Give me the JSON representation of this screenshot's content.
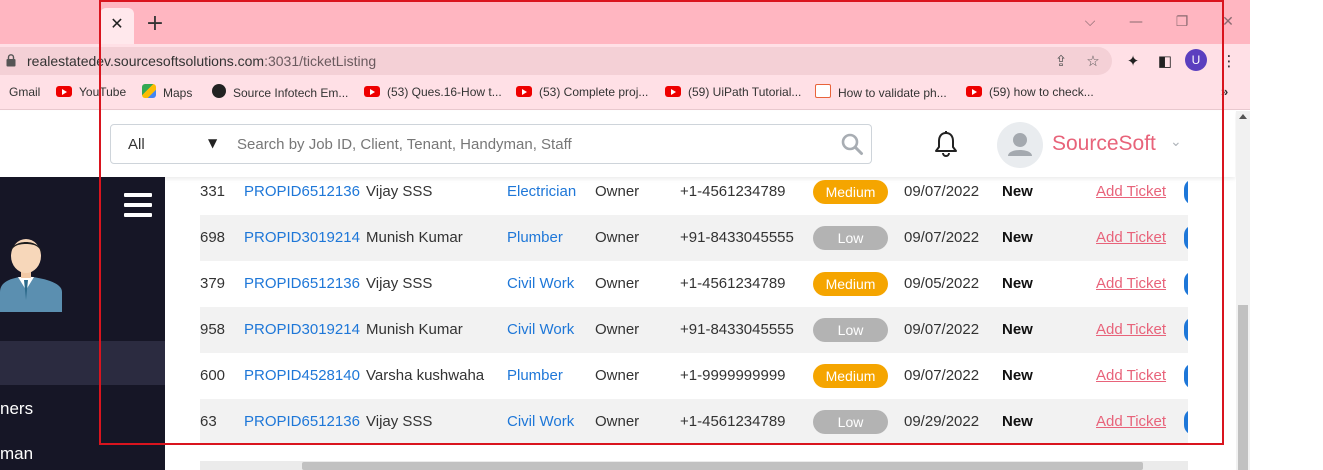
{
  "browser": {
    "tab_close": "✕",
    "new_tab": "+",
    "window_controls": {
      "tab_search": "⌵",
      "minimize": "—",
      "restore": "❐",
      "close": "✕"
    },
    "url_host": "realestatedev.sourcesoftsolutions.com",
    "url_path": ":3031/ticketListing",
    "profile_initial": "U",
    "bookmarks": [
      {
        "label": "Gmail",
        "icon": "gmail-icon"
      },
      {
        "label": "YouTube",
        "icon": "youtube-icon"
      },
      {
        "label": "Maps",
        "icon": "maps-icon"
      },
      {
        "label": "Source Infotech Em...",
        "icon": "globe-icon"
      },
      {
        "label": "(53) Ques.16-How t...",
        "icon": "youtube-icon"
      },
      {
        "label": "(53) Complete proj...",
        "icon": "youtube-icon"
      },
      {
        "label": "(59) UiPath Tutorial...",
        "icon": "youtube-icon"
      },
      {
        "label": "How to validate ph...",
        "icon": "uipath-icon"
      },
      {
        "label": "(59) how to check...",
        "icon": "youtube-icon"
      }
    ],
    "bookmarks_more": "»"
  },
  "header": {
    "filter_selected": "All",
    "search_placeholder": "Search by Job ID, Client, Tenant, Handyman, Staff",
    "brand": "SourceSoft",
    "brand_chevron": "⌄"
  },
  "sidebar": {
    "items": [
      {
        "label": "ners"
      },
      {
        "label": "man"
      }
    ]
  },
  "table": {
    "rows": [
      {
        "id": "331",
        "property": "PROPID6512136",
        "client": "Vijay SSS",
        "job_type": "Electrician",
        "role": "Owner",
        "phone": "+1-4561234789",
        "priority": "Medium",
        "date": "09/07/2022",
        "status": "New",
        "action": "Add Ticket"
      },
      {
        "id": "698",
        "property": "PROPID3019214",
        "client": "Munish Kumar",
        "job_type": "Plumber",
        "role": "Owner",
        "phone": "+91-8433045555",
        "priority": "Low",
        "date": "09/07/2022",
        "status": "New",
        "action": "Add Ticket"
      },
      {
        "id": "379",
        "property": "PROPID6512136",
        "client": "Vijay SSS",
        "job_type": "Civil Work",
        "role": "Owner",
        "phone": "+1-4561234789",
        "priority": "Medium",
        "date": "09/05/2022",
        "status": "New",
        "action": "Add Ticket"
      },
      {
        "id": "958",
        "property": "PROPID3019214",
        "client": "Munish Kumar",
        "job_type": "Civil Work",
        "role": "Owner",
        "phone": "+91-8433045555",
        "priority": "Low",
        "date": "09/07/2022",
        "status": "New",
        "action": "Add Ticket"
      },
      {
        "id": "600",
        "property": "PROPID4528140",
        "client": "Varsha kushwaha",
        "job_type": "Plumber",
        "role": "Owner",
        "phone": "+1-9999999999",
        "priority": "Medium",
        "date": "09/07/2022",
        "status": "New",
        "action": "Add Ticket"
      },
      {
        "id": "63",
        "property": "PROPID6512136",
        "client": "Vijay SSS",
        "job_type": "Civil Work",
        "role": "Owner",
        "phone": "+1-4561234789",
        "priority": "Low",
        "date": "09/29/2022",
        "status": "New",
        "action": "Add Ticket"
      }
    ]
  },
  "colors": {
    "tabstrip": "#ffb6c1",
    "toolbar": "#ffe0e6",
    "link": "#1e77d8",
    "brand": "#e8637a",
    "priority_medium": "#f5a500",
    "priority_low": "#b3b3b3",
    "sidebar": "#161626",
    "annotation": "#d9141e"
  }
}
